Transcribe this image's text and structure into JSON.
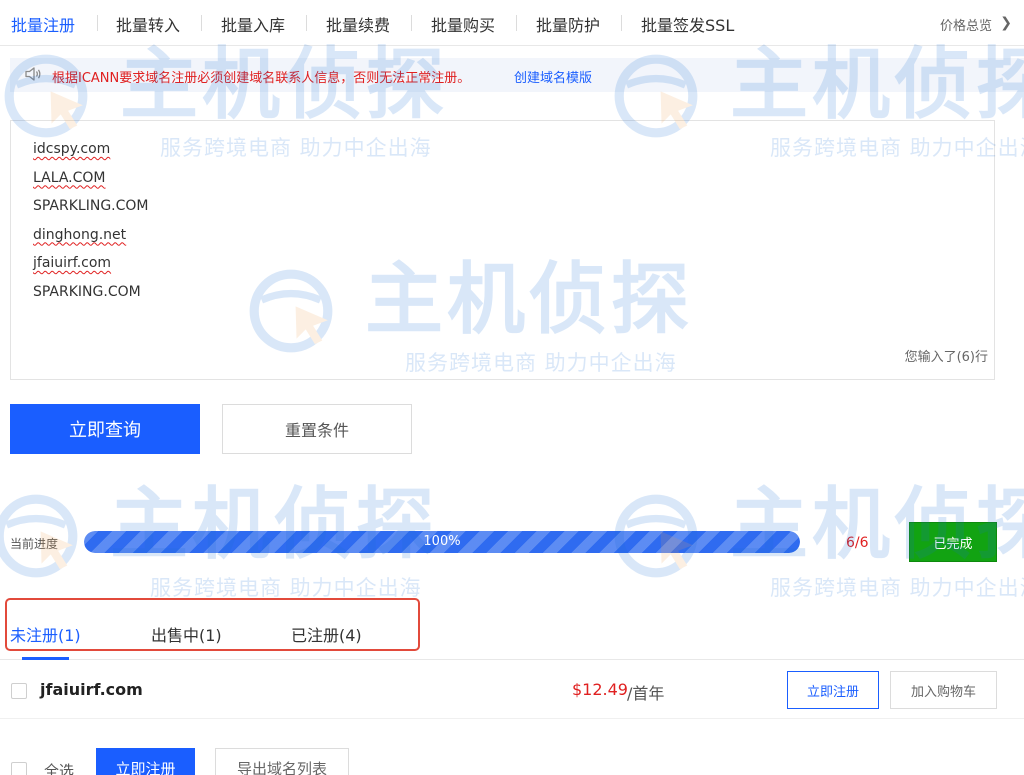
{
  "top_tabs": {
    "items": [
      {
        "label": "批量注册",
        "active": true
      },
      {
        "label": "批量转入",
        "active": false
      },
      {
        "label": "批量入库",
        "active": false
      },
      {
        "label": "批量续费",
        "active": false
      },
      {
        "label": "批量购买",
        "active": false
      },
      {
        "label": "批量防护",
        "active": false
      },
      {
        "label": "批量签发SSL",
        "active": false
      }
    ],
    "price_overview": "价格总览"
  },
  "notice": {
    "text": "根据ICANN要求域名注册必须创建域名联系人信息，否则无法正常注册。",
    "link": "创建域名模版"
  },
  "domain_input": {
    "lines": [
      "idcspy.com",
      "LALA.COM",
      "SPARKLING.COM",
      "dinghong.net",
      "jfaiuirf.com",
      "SPARKING.COM"
    ],
    "count_text": "您输入了(6)行"
  },
  "buttons": {
    "query": "立即查询",
    "reset": "重置条件"
  },
  "progress": {
    "label": "当前进度",
    "percent": 100,
    "percent_text": "100%",
    "count": "6/6",
    "status": "已完成"
  },
  "result_tabs": {
    "items": [
      {
        "label": "未注册(1)",
        "active": true
      },
      {
        "label": "出售中(1)",
        "active": false
      },
      {
        "label": "已注册(4)",
        "active": false
      }
    ]
  },
  "results": [
    {
      "domain": "jfaiuirf.com",
      "price": "$12.49",
      "unit": "/首年",
      "register_label": "立即注册",
      "cart_label": "加入购物车"
    }
  ],
  "footer": {
    "select_all": "全选",
    "bulk_register": "立即注册",
    "export": "导出域名列表"
  },
  "watermark": {
    "title": "主机侦探",
    "subtitle": "服务跨境电商 助力中企出海"
  },
  "colors": {
    "accent": "#1a5eff",
    "error": "#e02020",
    "success": "#12a312",
    "highlight": "#e24a3b"
  },
  "icons": {
    "notice": "speaker-icon",
    "price_overview": "chevron-right-icon",
    "watermark": "globe-logo-icon"
  }
}
